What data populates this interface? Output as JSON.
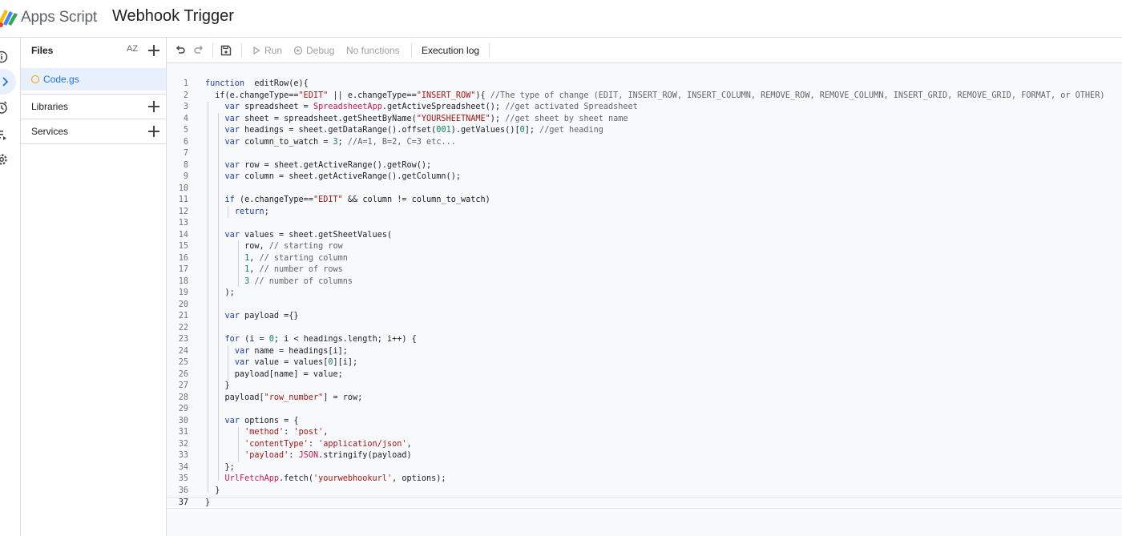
{
  "header": {
    "product_name": "Apps Script",
    "project_title": "Webhook Trigger"
  },
  "rail": {
    "icons": [
      "info-icon",
      "editor-icon",
      "triggers-icon",
      "executions-icon",
      "settings-icon"
    ]
  },
  "files_panel": {
    "files_label": "Files",
    "sort_label": "AZ",
    "files": [
      "Code.gs"
    ],
    "libraries_label": "Libraries",
    "services_label": "Services"
  },
  "toolbar": {
    "run_label": "Run",
    "debug_label": "Debug",
    "function_select": "No functions",
    "execution_log_label": "Execution log"
  },
  "editor": {
    "current_line": 37,
    "lines": [
      [
        [
          "kw",
          "function"
        ],
        [
          "",
          "  editRow(e){"
        ]
      ],
      [
        [
          "",
          "  if(e.changeType=="
        ],
        [
          "str",
          "\"EDIT\""
        ],
        [
          "",
          " || e.changeType=="
        ],
        [
          "str",
          "\"INSERT_ROW\""
        ],
        [
          "",
          "){ "
        ],
        [
          "cm",
          "//The type of change (EDIT, INSERT_ROW, INSERT_COLUMN, REMOVE_ROW, REMOVE_COLUMN, INSERT_GRID, REMOVE_GRID, FORMAT, or OTHER)"
        ]
      ],
      [
        [
          "",
          "    "
        ],
        [
          "kw",
          "var"
        ],
        [
          "",
          " spreadsheet = "
        ],
        [
          "cls",
          "SpreadsheetApp"
        ],
        [
          "",
          ".getActiveSpreadsheet(); "
        ],
        [
          "cm",
          "//get activated Spreadsheet"
        ]
      ],
      [
        [
          "",
          "    "
        ],
        [
          "kw",
          "var"
        ],
        [
          "",
          " sheet = spreadsheet.getSheetByName("
        ],
        [
          "str",
          "\"YOURSHEETNAME\""
        ],
        [
          "",
          "); "
        ],
        [
          "cm",
          "//get sheet by sheet name"
        ]
      ],
      [
        [
          "",
          "    "
        ],
        [
          "kw",
          "var"
        ],
        [
          "",
          " headings = sheet.getDataRange().offset("
        ],
        [
          "num",
          "0"
        ],
        [
          ", "
        ],
        [
          "num",
          "0"
        ],
        [
          ", "
        ],
        [
          "num",
          "1"
        ],
        [
          "",
          ").getValues()["
        ],
        [
          "num",
          "0"
        ],
        [
          "",
          "]; "
        ],
        [
          "cm",
          "//get heading"
        ]
      ],
      [
        [
          "",
          "    "
        ],
        [
          "kw",
          "var"
        ],
        [
          "",
          " column_to_watch = "
        ],
        [
          "num",
          "3"
        ],
        [
          "",
          "; "
        ],
        [
          "cm",
          "//A=1, B=2, C=3 etc..."
        ]
      ],
      [],
      [
        [
          "",
          "    "
        ],
        [
          "kw",
          "var"
        ],
        [
          "",
          " row = sheet.getActiveRange().getRow();"
        ]
      ],
      [
        [
          "",
          "    "
        ],
        [
          "kw",
          "var"
        ],
        [
          "",
          " column = sheet.getActiveRange().getColumn();"
        ]
      ],
      [],
      [
        [
          "",
          "    "
        ],
        [
          "kw",
          "if"
        ],
        [
          "",
          " (e.changeType=="
        ],
        [
          "str",
          "\"EDIT\""
        ],
        [
          "",
          " && column != column_to_watch)"
        ]
      ],
      [
        [
          "",
          "      "
        ],
        [
          "kw",
          "return"
        ],
        [
          "",
          ";"
        ]
      ],
      [],
      [
        [
          "",
          "    "
        ],
        [
          "kw",
          "var"
        ],
        [
          "",
          " values = sheet.getSheetValues("
        ]
      ],
      [
        [
          "",
          "        row, "
        ],
        [
          "cm",
          "// starting row"
        ]
      ],
      [
        [
          "",
          "        "
        ],
        [
          "num",
          "1"
        ],
        [
          "",
          ", "
        ],
        [
          "cm",
          "// starting column"
        ]
      ],
      [
        [
          "",
          "        "
        ],
        [
          "num",
          "1"
        ],
        [
          "",
          ", "
        ],
        [
          "cm",
          "// number of rows"
        ]
      ],
      [
        [
          "",
          "        "
        ],
        [
          "num",
          "3"
        ],
        [
          "",
          " "
        ],
        [
          "cm",
          "// number of columns"
        ]
      ],
      [
        [
          "",
          "    );"
        ]
      ],
      [],
      [
        [
          "",
          "    "
        ],
        [
          "kw",
          "var"
        ],
        [
          "",
          " payload ={}"
        ]
      ],
      [],
      [
        [
          "",
          "    "
        ],
        [
          "kw",
          "for"
        ],
        [
          "",
          " (i = "
        ],
        [
          "num",
          "0"
        ],
        [
          "",
          "; i < headings.length; i++) {"
        ]
      ],
      [
        [
          "",
          "      "
        ],
        [
          "kw",
          "var"
        ],
        [
          "",
          " name = headings[i];"
        ]
      ],
      [
        [
          "",
          "      "
        ],
        [
          "kw",
          "var"
        ],
        [
          "",
          " value = values["
        ],
        [
          "num",
          "0"
        ],
        [
          "",
          "][i];"
        ]
      ],
      [
        [
          "",
          "      payload[name] = value;"
        ]
      ],
      [
        [
          "",
          "    }"
        ]
      ],
      [
        [
          "",
          "    payload["
        ],
        [
          "str",
          "\"row_number\""
        ],
        [
          "",
          "] = row;"
        ]
      ],
      [],
      [
        [
          "",
          "    "
        ],
        [
          "kw",
          "var"
        ],
        [
          "",
          " options = {"
        ]
      ],
      [
        [
          "",
          "        "
        ],
        [
          "str",
          "'method'"
        ],
        [
          "",
          ": "
        ],
        [
          "str",
          "'post'"
        ],
        [
          "",
          ","
        ]
      ],
      [
        [
          "",
          "        "
        ],
        [
          "str",
          "'contentType'"
        ],
        [
          "",
          ": "
        ],
        [
          "str",
          "'application/json'"
        ],
        [
          "",
          ","
        ]
      ],
      [
        [
          "",
          "        "
        ],
        [
          "str",
          "'payload'"
        ],
        [
          "",
          ": "
        ],
        [
          "cls",
          "JSON"
        ],
        [
          "",
          ".stringify(payload)"
        ]
      ],
      [
        [
          "",
          "    };"
        ]
      ],
      [
        [
          "",
          "    "
        ],
        [
          "cls",
          "UrlFetchApp"
        ],
        [
          "",
          ".fetch("
        ],
        [
          "str",
          "'yourwebhookurl'"
        ],
        [
          "",
          ", options);"
        ]
      ],
      [
        [
          "",
          "  }"
        ]
      ],
      [
        [
          "",
          "}"
        ]
      ]
    ]
  }
}
